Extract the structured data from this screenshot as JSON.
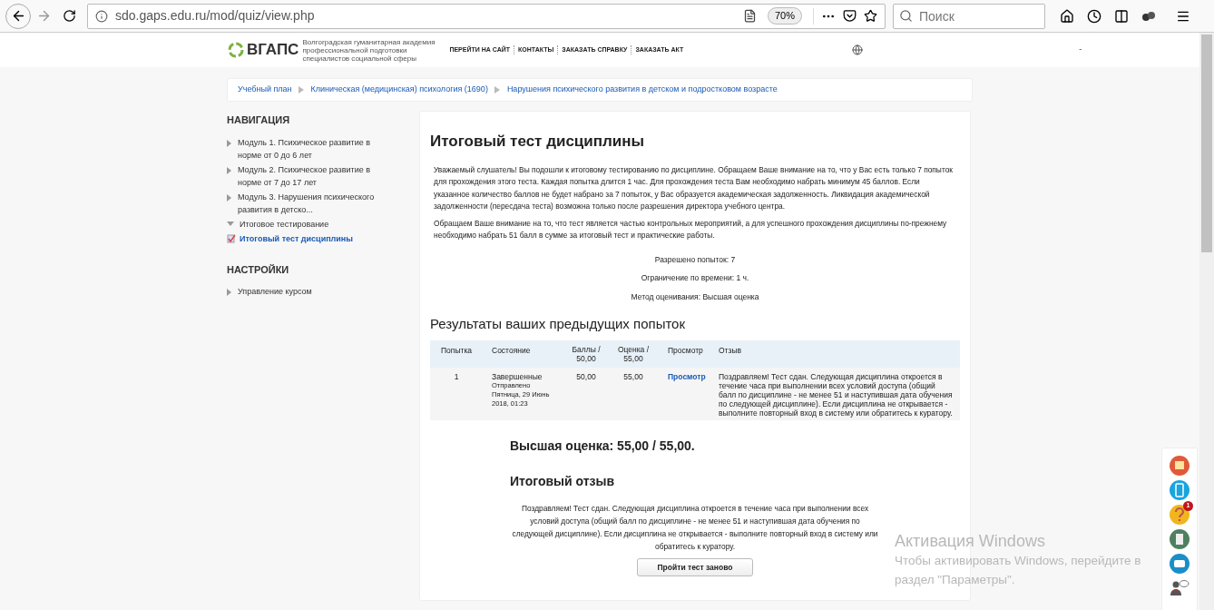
{
  "browser": {
    "url": "sdo.gaps.edu.ru/mod/quiz/view.php",
    "zoom": "70%",
    "search_placeholder": "Поиск"
  },
  "site_header": {
    "logo": "ВГАПС",
    "logo_subtitle": "Волгоградская гуманитарная академия профессиональной подготовки специалистов социальной сферы",
    "menu": [
      "ПЕРЕЙТИ НА САЙТ",
      "КОНТАКТЫ",
      "ЗАКАЗАТЬ СПРАВКУ",
      "ЗАКАЗАТЬ АКТ"
    ],
    "user_mark": "-"
  },
  "breadcrumb": [
    "Учебный план",
    "Клиническая (медицинская) психология (1690)",
    "Нарушения психического развития в детском и подростковом возрасте"
  ],
  "navigation": {
    "title": "НАВИГАЦИЯ",
    "items": [
      {
        "label": "Модуль 1. Психическое развитие в норме от 0 до 6 лет",
        "expanded": false
      },
      {
        "label": "Модуль 2. Психическое развитие в норме от 7 до 17 лет",
        "expanded": false
      },
      {
        "label": "Модуль 3. Нарушения психического развития в детско...",
        "expanded": false
      },
      {
        "label": "Итоговое тестирование",
        "expanded": true,
        "children": [
          {
            "label": "Итоговый тест дисциплины",
            "selected": true
          }
        ]
      }
    ]
  },
  "settings": {
    "title": "НАСТРОЙКИ",
    "items": [
      {
        "label": "Управление курсом",
        "expanded": false
      }
    ]
  },
  "quiz": {
    "title": "Итоговый тест дисциплины",
    "intro": [
      "Уважаемый слушатель! Вы подошли к итоговому тестированию по дисциплине. Обращаем Ваше внимание на то, что у Вас есть только 7 попыток для прохождения этого теста.  Каждая попытка длится 1 час. Для прохождения теста Вам необходимо набрать минимум 45 баллов. Если указанное количество баллов не будет набрано за 7 попыток, у Вас образуется академическая задолженность. Ликвидация академической задолженности (пересдача теста) возможна только после разрешения директора учебного центра.",
      "Обращаем Ваше внимание на то, что тест является частью контрольных мероприятий, а для успешного прохождения дисциплины по-прежнему необходимо набрать 51 балл в сумме за итоговый тест и практические работы."
    ],
    "info": [
      "Разрешено попыток: 7",
      "Ограничение по времени: 1 ч.",
      "Метод оценивания: Высшая оценка"
    ],
    "results_title": "Результаты ваших предыдущих попыток",
    "table": {
      "columns": [
        "Попытка",
        "Состояние",
        "Баллы / 50,00",
        "Оценка / 55,00",
        "Просмотр",
        "Отзыв"
      ],
      "rows": [
        {
          "attempt": "1",
          "state": "Завершенные",
          "submitted": "Отправлено Пятница, 29 Июнь 2018, 01:23",
          "marks": "50,00",
          "grade": "55,00",
          "review": "Просмотр",
          "feedback": "Поздравляем! Тест сдан. Следующая дисциплина откроется в течение часа при выполнении всех условий доступа (общий балл по дисциплине - не менее 51 и наступившая дата обучения по следующей дисциплине). Если дисциплина не открывается - выполните повторный вход в систему или обратитесь к куратору."
        }
      ]
    },
    "best_grade": "Высшая оценка: 55,00 / 55,00.",
    "feedback_title": "Итоговый отзыв",
    "feedback": "Поздравляем! Тест сдан. Следующая дисциплина откроется в течение часа при выполнении всех условий доступа (общий балл по дисциплине - не менее 51 и наступившая дата обучения по следующей дисциплине). Если дисциплина не открывается - выполните повторный вход в систему или обратитесь к куратору.",
    "button": "Пройти тест заново"
  },
  "widgets": [
    {
      "kind": "mail"
    },
    {
      "kind": "phone"
    },
    {
      "kind": "help",
      "badge": "1"
    },
    {
      "kind": "document"
    },
    {
      "kind": "chat"
    },
    {
      "kind": "person"
    }
  ],
  "windows_activation": {
    "title": "Активация Windows",
    "text": "Чтобы активировать Windows, перейдите в раздел \"Параметры\"."
  }
}
